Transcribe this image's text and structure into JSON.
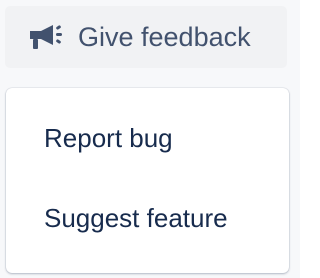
{
  "feedback_button": {
    "label": "Give feedback",
    "icon": "megaphone-icon",
    "text_color": "#42526e",
    "background_color": "#f1f2f4"
  },
  "menu": {
    "items": [
      {
        "label": "Report bug"
      },
      {
        "label": "Suggest feature"
      }
    ],
    "text_color": "#172b4d",
    "background_color": "#ffffff"
  }
}
